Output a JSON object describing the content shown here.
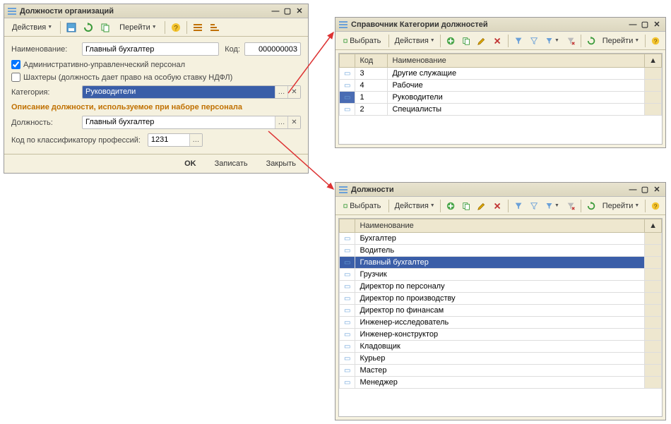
{
  "win1": {
    "title": "Должности организаций",
    "toolbar": {
      "actions": "Действия",
      "go": "Перейти"
    },
    "labels": {
      "name": "Наименование:",
      "code": "Код:",
      "cb_admin": "Административно-управленческий персонал",
      "cb_miners": "Шахтеры (должность дает право на особую ставку НДФЛ)",
      "category": "Категория:",
      "section": "Описание должности, используемое при наборе персонала",
      "position": "Должность:",
      "classifier": "Код по классификатору профессий:"
    },
    "values": {
      "name": "Главный бухгалтер",
      "code": "000000003",
      "category": "Руководители",
      "position": "Главный бухгалтер",
      "classifier": "1231"
    },
    "buttons": {
      "ok": "OK",
      "write": "Записать",
      "close": "Закрыть"
    }
  },
  "win2": {
    "title": "Справочник Категории должностей",
    "toolbar": {
      "select": "Выбрать",
      "actions": "Действия",
      "go": "Перейти"
    },
    "cols": {
      "code": "Код",
      "name": "Наименование"
    },
    "rows": [
      {
        "code": "3",
        "name": "Другие служащие"
      },
      {
        "code": "4",
        "name": "Рабочие"
      },
      {
        "code": "1",
        "name": "Руководители"
      },
      {
        "code": "2",
        "name": "Специалисты"
      }
    ],
    "selectedIndex": 2
  },
  "win3": {
    "title": "Должности",
    "toolbar": {
      "select": "Выбрать",
      "actions": "Действия",
      "go": "Перейти"
    },
    "cols": {
      "name": "Наименование"
    },
    "rows": [
      "Бухгалтер",
      "Водитель",
      "Главный бухгалтер",
      "Грузчик",
      "Директор по персоналу",
      "Директор по производству",
      "Директор по финансам",
      "Инженер-исследователь",
      "Инженер-конструктор",
      "Кладовщик",
      "Курьер",
      "Мастер",
      "Менеджер"
    ],
    "selectedIndex": 2
  }
}
